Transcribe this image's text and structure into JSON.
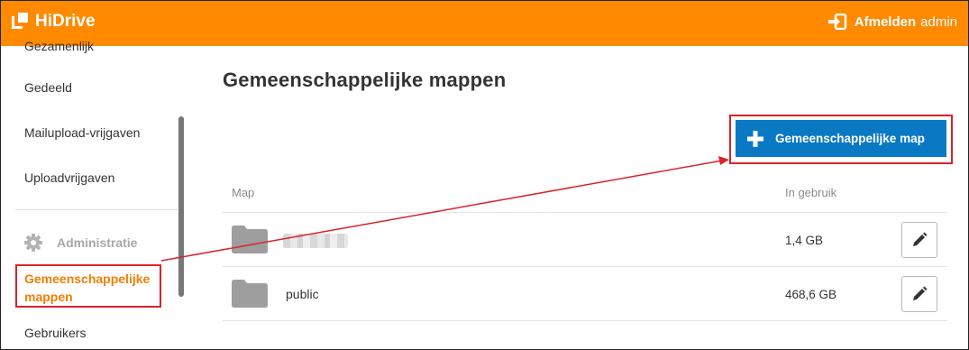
{
  "header": {
    "logo_text": "HiDrive",
    "logout_label": "Afmelden",
    "username": "admin",
    "background_color": "#ff8a00"
  },
  "sidebar": {
    "cut_item": "Gezamenlijk",
    "items": [
      {
        "label": "Gedeeld"
      },
      {
        "label": "Mailupload-vrijgaven"
      },
      {
        "label": "Uploadvrijgaven"
      }
    ],
    "section_label": "Administratie",
    "section_icon": "gear-icon",
    "active_item": "Gemeenschappelijke mappen",
    "after_items": [
      {
        "label": "Gebruikers"
      }
    ],
    "active_color": "#f07f00"
  },
  "main": {
    "title": "Gemeenschappelijke mappen",
    "add_button_label": "Gemeenschappelijke map",
    "add_button_color": "#0a79c4",
    "columns": {
      "name": "Map",
      "usage": "In gebruik"
    },
    "rows": [
      {
        "name": "",
        "usage": "1,4 GB",
        "name_obscured": true
      },
      {
        "name": "public",
        "usage": "468,6 GB"
      }
    ]
  },
  "annotation": {
    "highlight_color": "#d9232a"
  }
}
